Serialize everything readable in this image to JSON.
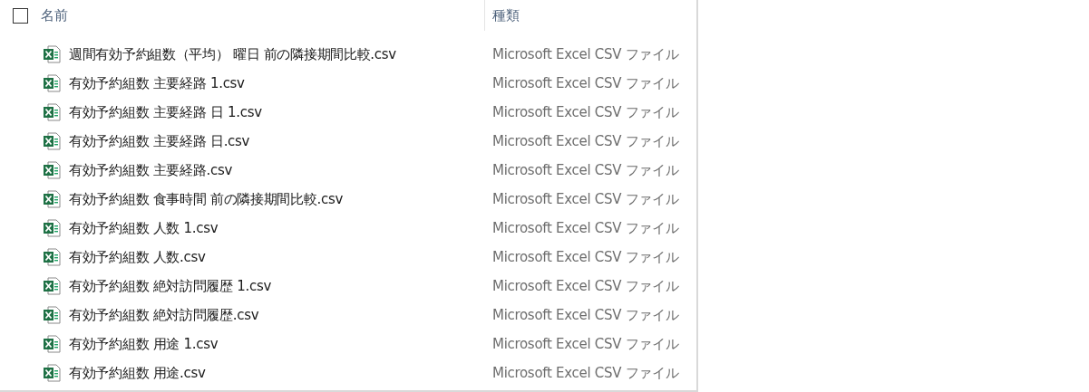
{
  "header": {
    "select_all": {
      "checked": false
    },
    "columns": [
      "名前",
      "種類"
    ]
  },
  "files": [
    {
      "name": "週間有効予約組数（平均） 曜日 前の隣接期間比較.csv",
      "type": "Microsoft Excel CSV ファイル"
    },
    {
      "name": "有効予約組数 主要経路 1.csv",
      "type": "Microsoft Excel CSV ファイル"
    },
    {
      "name": "有効予約組数 主要経路 日 1.csv",
      "type": "Microsoft Excel CSV ファイル"
    },
    {
      "name": "有効予約組数 主要経路 日.csv",
      "type": "Microsoft Excel CSV ファイル"
    },
    {
      "name": "有効予約組数 主要経路.csv",
      "type": "Microsoft Excel CSV ファイル"
    },
    {
      "name": "有効予約組数 食事時間 前の隣接期間比較.csv",
      "type": "Microsoft Excel CSV ファイル"
    },
    {
      "name": "有効予約組数 人数 1.csv",
      "type": "Microsoft Excel CSV ファイル"
    },
    {
      "name": "有効予約組数 人数.csv",
      "type": "Microsoft Excel CSV ファイル"
    },
    {
      "name": "有効予約組数 絶対訪問履歴 1.csv",
      "type": "Microsoft Excel CSV ファイル"
    },
    {
      "name": "有効予約組数 絶対訪問履歴.csv",
      "type": "Microsoft Excel CSV ファイル"
    },
    {
      "name": "有効予約組数 用途 1.csv",
      "type": "Microsoft Excel CSV ファイル"
    },
    {
      "name": "有効予約組数 用途.csv",
      "type": "Microsoft Excel CSV ファイル"
    }
  ]
}
